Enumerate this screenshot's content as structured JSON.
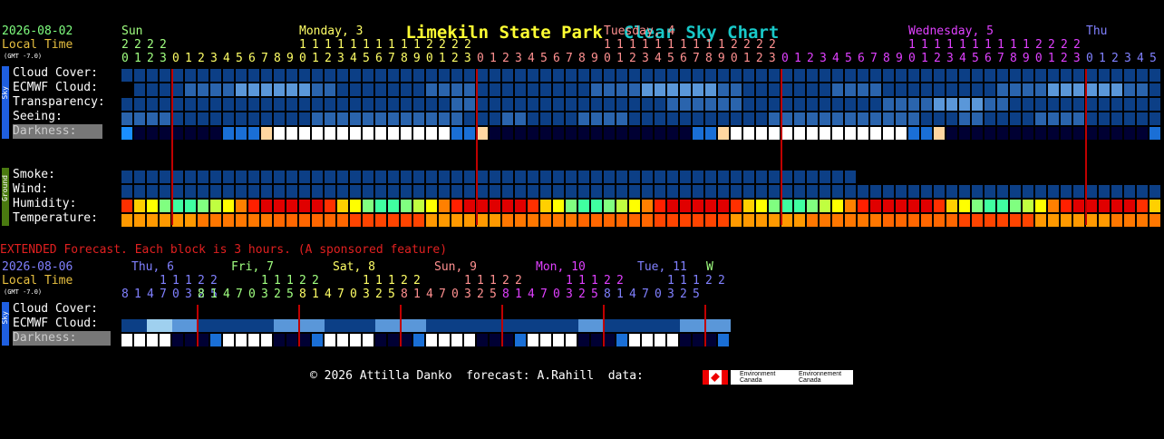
{
  "title": {
    "location": "Limekiln State Park",
    "chart": "Clear Sky Chart"
  },
  "main": {
    "date": "2026-08-02",
    "local_time": "Local Time",
    "gmt": "(GMT -7.0)",
    "days": [
      {
        "label": "Sun",
        "color": "#a0ff80"
      },
      {
        "label": "Monday, 3",
        "color": "#ffff66"
      },
      {
        "label": "Tuesday, 4",
        "color": "#ff9090"
      },
      {
        "label": "Wednesday, 5",
        "color": "#e040ff"
      },
      {
        "label": "Thu",
        "color": "#8080ff"
      }
    ],
    "tens_rows": [
      {
        "text": "2222",
        "color": "#a0ff80"
      },
      {
        "text": "11111111112222",
        "color": "#ffff66"
      },
      {
        "text": "11111111112222",
        "color": "#ff9090"
      },
      {
        "text": "11111111112222",
        "color": "#e040ff"
      }
    ],
    "hour_rows": [
      {
        "text": "0123",
        "color": "#a0ff80"
      },
      {
        "text": "012345678901234567890123",
        "color": "#ffff66"
      },
      {
        "text": "012345678901234567890123",
        "color": "#ff9090"
      },
      {
        "text": "012345678901234567890123",
        "color": "#e040ff"
      },
      {
        "text": "012345",
        "color": "#8080ff"
      }
    ],
    "sky_tag": "Sky",
    "ground_tag": "Ground",
    "rows": {
      "cloud_cover": "Cloud Cover:",
      "ecmwf_cloud": "ECMWF Cloud:",
      "transparency": "Transparency:",
      "seeing": "Seeing:",
      "darkness": "Darkness:",
      "smoke": "Smoke:",
      "wind": "Wind:",
      "humidity": "Humidity:",
      "temperature": "Temperature:"
    }
  },
  "extended": {
    "banner": "EXTENDED Forecast. Each block is 3 hours. (A sponsored feature)",
    "date": "2026-08-06",
    "local_time": "Local Time",
    "gmt": "(GMT -7.0)",
    "days": [
      {
        "label": "Thu, 6",
        "color": "#8080ff"
      },
      {
        "label": "Fri, 7",
        "color": "#a0ff80"
      },
      {
        "label": "Sat, 8",
        "color": "#ffff66"
      },
      {
        "label": "Sun, 9",
        "color": "#ff9090"
      },
      {
        "label": "Mon, 10",
        "color": "#e040ff"
      },
      {
        "label": "Tue, 11",
        "color": "#8080ff"
      },
      {
        "label": "W",
        "color": "#a0ff80"
      }
    ],
    "tens_rows": [
      {
        "text": "11122",
        "color": "#8080ff"
      },
      {
        "text": "11122",
        "color": "#a0ff80"
      },
      {
        "text": "11122",
        "color": "#ffff66"
      },
      {
        "text": "11122",
        "color": "#ff9090"
      },
      {
        "text": "11122",
        "color": "#e040ff"
      },
      {
        "text": "11122",
        "color": "#8080ff"
      }
    ],
    "hour_rows": [
      {
        "text": "81470325",
        "color": "#8080ff"
      },
      {
        "text": "81470325",
        "color": "#a0ff80"
      },
      {
        "text": "81470325",
        "color": "#ffff66"
      },
      {
        "text": "81470325",
        "color": "#ff9090"
      },
      {
        "text": "81470325",
        "color": "#e040ff"
      },
      {
        "text": "81470325",
        "color": "#8080ff"
      },
      {
        "text": "",
        "color": "#a0ff80"
      }
    ],
    "sky_tag": "Sky",
    "rows": {
      "cloud_cover": "Cloud Cover:",
      "ecmwf_cloud": "ECMWF Cloud:",
      "darkness": "Darkness:"
    }
  },
  "footer": {
    "copyright": "© 2026 Attilla Danko  forecast: A.Rahill  data:",
    "logo_text_1": "Environment Canada",
    "logo_text_2": "Environnement Canada"
  },
  "colors": {
    "sky_dark": "#0c3f86",
    "sky_mid": "#2a64ad",
    "sky_light": "#5a97d9",
    "sky_pale": "#9fd0ef",
    "dark_night": "#000033",
    "twilight": "#1a6fd6",
    "day": "#ffffff",
    "humid_red": "#e00000",
    "humid_green": "#80ff80",
    "temp_orange": "#ff6600",
    "day_separator": "#c00000"
  }
}
